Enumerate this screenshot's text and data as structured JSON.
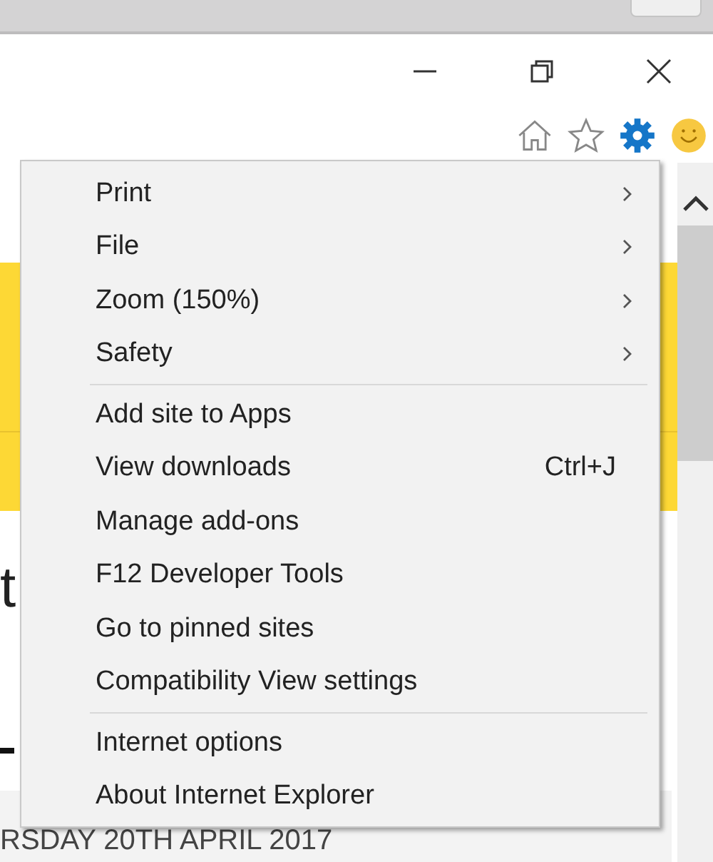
{
  "caption_buttons": [
    {
      "kind": "minimize"
    },
    {
      "kind": "restore"
    },
    {
      "kind": "close"
    }
  ],
  "toolbar": [
    {
      "kind": "home"
    },
    {
      "kind": "favorites"
    },
    {
      "kind": "tools"
    },
    {
      "kind": "feedback"
    }
  ],
  "page": {
    "fragment_1": "t",
    "date_line": "RSDAY 20TH APRIL 2017"
  },
  "menu": {
    "groups": [
      [
        {
          "label": "Print",
          "submenu": true
        },
        {
          "label": "File",
          "submenu": true
        },
        {
          "label": "Zoom (150%)",
          "submenu": true
        },
        {
          "label": "Safety",
          "submenu": true
        }
      ],
      [
        {
          "label": "Add site to Apps",
          "submenu": false
        },
        {
          "label": "View downloads",
          "submenu": false,
          "shortcut": "Ctrl+J"
        },
        {
          "label": "Manage add-ons",
          "submenu": false
        },
        {
          "label": "F12 Developer Tools",
          "submenu": false
        },
        {
          "label": "Go to pinned sites",
          "submenu": false
        },
        {
          "label": "Compatibility View settings",
          "submenu": false
        }
      ],
      [
        {
          "label": "Internet options",
          "submenu": false
        },
        {
          "label": "About Internet Explorer",
          "submenu": false
        }
      ]
    ]
  }
}
